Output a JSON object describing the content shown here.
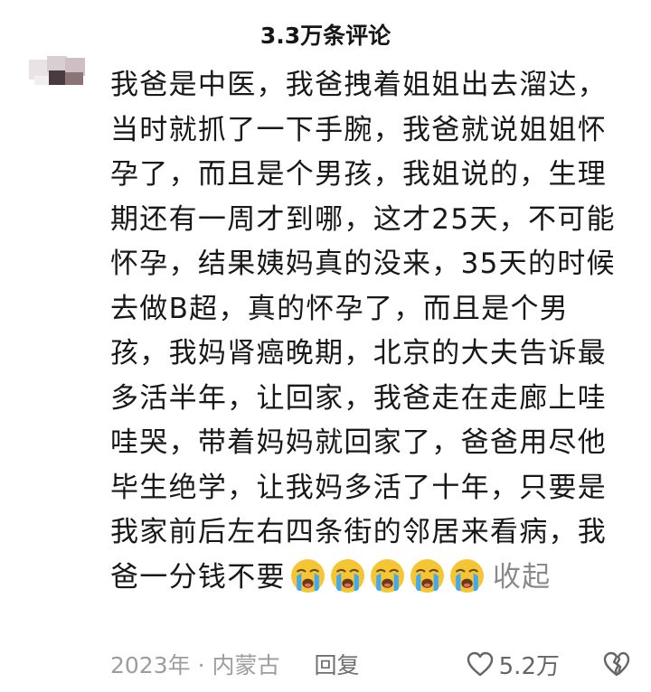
{
  "header": {
    "title": "3.3万条评论"
  },
  "comment": {
    "text": "我爸是中医，我爸拽着姐姐出去溜达，当时就抓了一下手腕，我爸就说姐姐怀孕了，而且是个男孩，我姐说的，生理期还有一周才到哪，这才25天，不可能怀孕，结果姨妈真的没来，35天的时候去做B超，真的怀孕了，而且是个男孩，我妈肾癌晚期，北京的大夫告诉最多活半年，让回家，我爸走在走廊上哇哇哭，带着妈妈就回家了，爸爸用尽他毕生绝学，让我妈多活了十年，只要是我家前后左右四条街的邻居来看病，我爸一分钱不要",
    "emoji_icon": "loudly-crying-face",
    "emoji_count": 5,
    "collapse_label": "收起"
  },
  "footer": {
    "meta": "2023年 · 内蒙古",
    "reply_label": "回复",
    "like_icon": "heart-outline",
    "like_count": "5.2万",
    "dislike_icon": "broken-heart"
  },
  "colors": {
    "text": "#181818",
    "secondary_text": "#9d9d9d",
    "emoji_face": "#f6c533",
    "emoji_tears": "#3fa9f5"
  }
}
